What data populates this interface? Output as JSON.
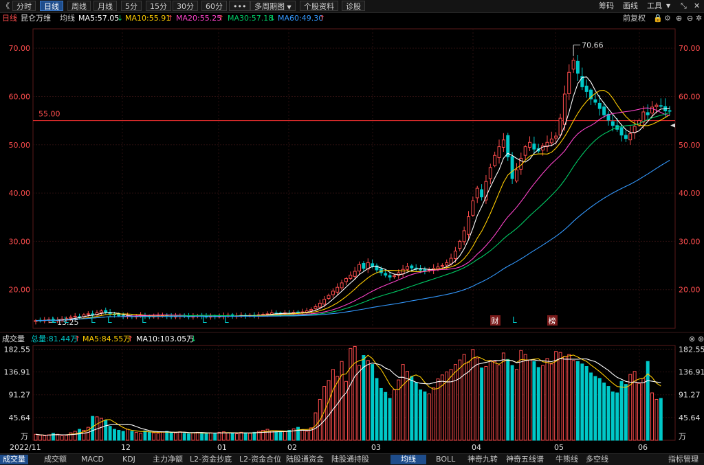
{
  "toolbar": {
    "back_glyph": "《",
    "tabs": [
      "分时",
      "日线",
      "周线",
      "月线",
      "5分",
      "15分",
      "30分",
      "60分",
      "•••",
      "多周期图",
      "个股资料",
      "诊股"
    ],
    "active_tab": "日线",
    "dropdown_glyph": "▼",
    "right": [
      "筹码",
      "画线",
      "工具"
    ],
    "window_glyphs": [
      "⤡",
      "✕"
    ]
  },
  "legend": {
    "period": "日线",
    "stock_name": "昆仑万维",
    "avg_label": "均线",
    "ma5": "MA5:57.05",
    "ma5_arrow": "↓",
    "ma10": "MA10:55.91",
    "ma10_arrow": "↑",
    "ma20": "MA20:55.25",
    "ma20_arrow": "↑",
    "ma30": "MA30:57.18",
    "ma30_arrow": "↓",
    "ma60": "MA60:49.30",
    "ma60_arrow": "↑",
    "adjust": "前复权",
    "colors": {
      "ma5": "#ffffff",
      "ma10": "#ffcc00",
      "ma20": "#ff44cc",
      "ma30": "#00cc66",
      "ma60": "#3399ff",
      "up": "#ff4d4d",
      "down": "#00c8c8"
    }
  },
  "volume_legend": {
    "title": "成交量",
    "total": "总量:81.44万",
    "total_arrow": "↑",
    "ma5": "MA5:84.55万",
    "ma5_arrow": "↑",
    "ma10": "MA10:103.05万",
    "ma10_arrow": "↓"
  },
  "markers": {
    "l_letter": "L",
    "cai": "财",
    "bang": "榜",
    "high_label": "70.66",
    "low_label": "13.25",
    "ref_line_label": "55.00"
  },
  "bottom_tabs": [
    "成交量",
    "成交额",
    "MACD",
    "KDJ",
    "主力净额",
    "L2-资金抄底",
    "L2-资金合位",
    "陆股通资金",
    "陆股通持股",
    "均线",
    "BOLL",
    "神奇九转",
    "神奇五线谱",
    "牛熊线",
    "多空线",
    "指标管理"
  ],
  "bottom_active": [
    "成交量",
    "均线"
  ],
  "chart_data": {
    "type": "candlestick",
    "title": "",
    "price_axis": {
      "ticks": [
        "20.00",
        "30.00",
        "40.00",
        "50.00",
        "60.00",
        "70.00"
      ],
      "ylim": [
        12,
        74
      ]
    },
    "volume_axis": {
      "ticks": [
        "182.55",
        "136.91",
        "91.27",
        "45.64"
      ],
      "unit": "万",
      "ylim": [
        0,
        190
      ]
    },
    "x_labels": [
      "2022/11",
      "12",
      "01",
      "02",
      "03",
      "04",
      "05",
      "06"
    ],
    "reference_line": 55.0,
    "high": 70.66,
    "low": 13.25,
    "close": [
      13.6,
      13.6,
      13.7,
      13.8,
      13.6,
      13.7,
      13.9,
      14.0,
      14.3,
      14.5,
      14.4,
      14.8,
      15.0,
      14.9,
      15.2,
      15.6,
      15.4,
      15.0,
      14.8,
      14.6,
      14.5,
      14.6,
      14.4,
      14.5,
      14.7,
      14.5,
      14.4,
      14.5,
      14.6,
      14.7,
      14.5,
      14.4,
      14.5,
      14.6,
      14.5,
      14.4,
      14.5,
      14.6,
      14.5,
      14.4,
      14.5,
      14.4,
      14.5,
      14.6,
      14.7,
      14.5,
      14.6,
      14.7,
      14.6,
      14.7,
      14.6,
      14.8,
      14.9,
      15.0,
      15.2,
      15.1,
      15.0,
      15.2,
      15.1,
      15.3,
      15.2,
      15.4,
      15.6,
      15.9,
      16.5,
      17.2,
      18.0,
      18.8,
      19.7,
      20.5,
      21.4,
      22.3,
      23.0,
      23.8,
      25.2,
      24.4,
      25.6,
      24.8,
      24.1,
      23.5,
      23.0,
      22.6,
      22.9,
      23.5,
      24.2,
      24.8,
      24.5,
      24.3,
      24.1,
      23.9,
      24.1,
      24.4,
      24.7,
      25.0,
      25.6,
      26.5,
      28.0,
      30.0,
      32.2,
      35.1,
      38.4,
      41.0,
      39.2,
      42.4,
      45.3,
      47.8,
      49.6,
      51.0,
      47.5,
      43.0,
      44.8,
      47.2,
      49.6,
      50.5,
      49.1,
      48.7,
      49.8,
      50.5,
      51.2,
      51.8,
      55.5,
      60.5,
      65.0,
      67.5,
      64.8,
      62.0,
      61.0,
      59.5,
      58.8,
      57.5,
      56.2,
      55.1,
      54.0,
      53.2,
      52.0,
      51.3,
      52.3,
      53.8,
      55.0,
      56.8,
      56.2,
      57.8,
      58.2,
      58.0,
      57.0,
      57.05
    ],
    "volume": [
      12,
      10,
      9,
      11,
      14,
      12,
      9,
      10,
      15,
      18,
      22,
      20,
      26,
      48,
      47,
      44,
      40,
      28,
      22,
      20,
      18,
      22,
      18,
      16,
      14,
      19,
      17,
      15,
      14,
      17,
      18,
      16,
      15,
      17,
      14,
      13,
      15,
      16,
      14,
      13,
      15,
      14,
      16,
      17,
      15,
      14,
      13,
      16,
      15,
      14,
      16,
      18,
      20,
      22,
      19,
      17,
      16,
      18,
      20,
      23,
      26,
      21,
      18,
      25,
      55,
      82,
      108,
      120,
      142,
      128,
      158,
      118,
      184,
      188,
      150,
      170,
      160,
      152,
      124,
      104,
      96,
      84,
      101,
      121,
      152,
      138,
      128,
      116,
      101,
      97,
      93,
      105,
      123,
      131,
      137,
      142,
      152,
      161,
      172,
      157,
      182,
      165,
      145,
      148,
      160,
      158,
      151,
      175,
      162,
      150,
      142,
      180,
      172,
      161,
      158,
      146,
      150,
      164,
      153,
      178,
      176,
      168,
      172,
      160,
      158,
      153,
      148,
      135,
      128,
      124,
      115,
      108,
      97,
      95,
      118,
      112,
      132,
      138,
      114,
      124,
      158,
      95,
      82,
      84
    ]
  }
}
